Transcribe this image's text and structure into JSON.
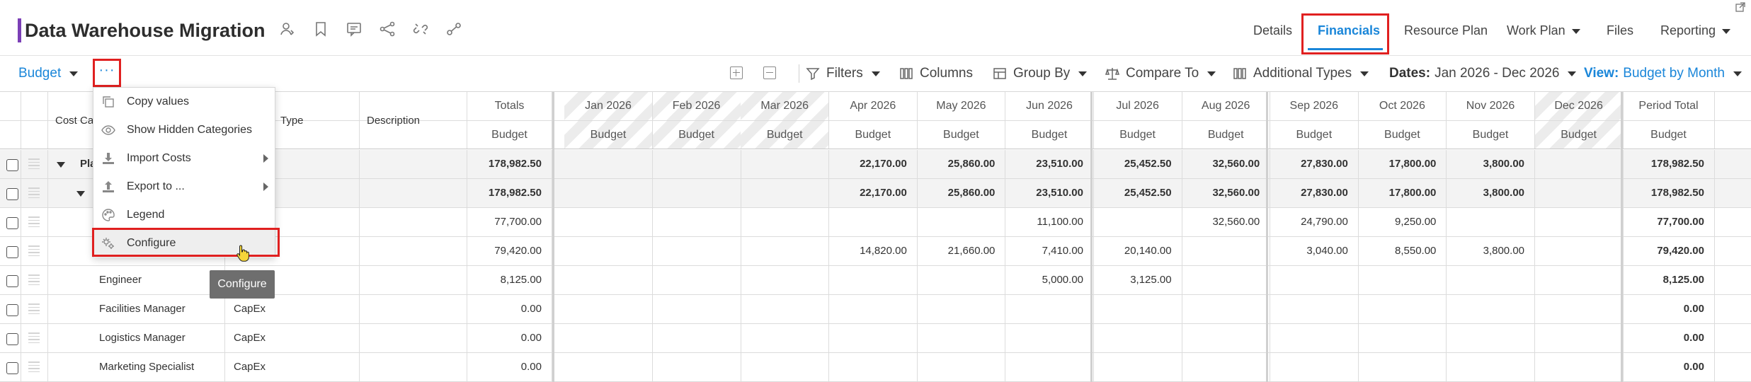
{
  "header": {
    "title": "Data Warehouse Migration",
    "icons": [
      "user-icon",
      "bookmark-icon",
      "comment-icon",
      "share-icon",
      "link-broken-icon",
      "link-icon"
    ],
    "tabs": [
      {
        "label": "Details",
        "active": false
      },
      {
        "label": "Financials",
        "active": true
      },
      {
        "label": "Resource Plan",
        "active": false
      },
      {
        "label": "Work Plan",
        "active": false,
        "dropdown": true
      },
      {
        "label": "Files",
        "active": false
      },
      {
        "label": "Reporting",
        "active": false,
        "dropdown": true
      }
    ],
    "accent_color": "#7b3fb6",
    "active_color": "#1a86d9",
    "highlight_color": "#e02020"
  },
  "toolbar": {
    "budget_label": "Budget",
    "more_label": "···",
    "filters_label": "Filters",
    "columns_label": "Columns",
    "group_by_label": "Group By",
    "compare_to_label": "Compare To",
    "additional_types_label": "Additional Types",
    "dates_prefix": "Dates:",
    "dates_value": "Jan 2026 - Dec 2026",
    "view_prefix": "View:",
    "view_value": "Budget by Month"
  },
  "menu": {
    "items": [
      {
        "label": "Copy values",
        "icon": "copy-icon"
      },
      {
        "label": "Show Hidden Categories",
        "icon": "eye-icon"
      },
      {
        "label": "Import Costs",
        "icon": "import-icon",
        "submenu": true
      },
      {
        "label": "Export to ...",
        "icon": "export-icon",
        "submenu": true
      },
      {
        "label": "Legend",
        "icon": "palette-icon"
      },
      {
        "label": "Configure",
        "icon": "gears-icon",
        "highlighted": true
      }
    ],
    "tooltip": "Configure"
  },
  "grid": {
    "headers": {
      "cost_category": "Cost Ca",
      "type": "Type",
      "description": "Description",
      "totals": "Totals",
      "months": [
        "Jan 2026",
        "Feb 2026",
        "Mar 2026",
        "Apr 2026",
        "May 2026",
        "Jun 2026",
        "Jul 2026",
        "Aug 2026",
        "Sep 2026",
        "Oct 2026",
        "Nov 2026",
        "Dec 2026"
      ],
      "period_total": "Period Total",
      "sub_label": "Budget"
    },
    "rows": [
      {
        "name": "Pla",
        "type": "",
        "total": "178,982.50",
        "months": [
          "",
          "",
          "",
          "22,170.00",
          "25,860.00",
          "23,510.00",
          "25,452.50",
          "32,560.00",
          "27,830.00",
          "17,800.00",
          "3,800.00",
          ""
        ],
        "period_total": "178,982.50",
        "bold": true,
        "shaded": true,
        "level": 0
      },
      {
        "name": "",
        "type": "",
        "total": "178,982.50",
        "months": [
          "",
          "",
          "",
          "22,170.00",
          "25,860.00",
          "23,510.00",
          "25,452.50",
          "32,560.00",
          "27,830.00",
          "17,800.00",
          "3,800.00",
          ""
        ],
        "period_total": "178,982.50",
        "bold": true,
        "shaded": true,
        "level": 1
      },
      {
        "name": "",
        "type": "",
        "total": "77,700.00",
        "months": [
          "",
          "",
          "",
          "",
          "",
          "11,100.00",
          "",
          "32,560.00",
          "24,790.00",
          "9,250.00",
          "",
          ""
        ],
        "period_total": "77,700.00",
        "bold": false,
        "shaded": false,
        "level": 2
      },
      {
        "name": "",
        "type": "",
        "total": "79,420.00",
        "months": [
          "",
          "",
          "",
          "14,820.00",
          "21,660.00",
          "7,410.00",
          "20,140.00",
          "",
          "3,040.00",
          "8,550.00",
          "3,800.00",
          ""
        ],
        "period_total": "79,420.00",
        "bold": false,
        "shaded": false,
        "level": 2
      },
      {
        "name": "Engineer",
        "type": "",
        "total": "8,125.00",
        "months": [
          "",
          "",
          "",
          "",
          "",
          "5,000.00",
          "3,125.00",
          "",
          "",
          "",
          "",
          ""
        ],
        "period_total": "8,125.00",
        "bold": false,
        "shaded": false,
        "level": 2
      },
      {
        "name": "Facilities Manager",
        "type": "CapEx",
        "total": "0.00",
        "months": [
          "",
          "",
          "",
          "",
          "",
          "",
          "",
          "",
          "",
          "",
          "",
          ""
        ],
        "period_total": "0.00",
        "bold": false,
        "shaded": false,
        "level": 2
      },
      {
        "name": "Logistics Manager",
        "type": "CapEx",
        "total": "0.00",
        "months": [
          "",
          "",
          "",
          "",
          "",
          "",
          "",
          "",
          "",
          "",
          "",
          ""
        ],
        "period_total": "0.00",
        "bold": false,
        "shaded": false,
        "level": 2
      },
      {
        "name": "Marketing Specialist",
        "type": "CapEx",
        "total": "0.00",
        "months": [
          "",
          "",
          "",
          "",
          "",
          "",
          "",
          "",
          "",
          "",
          "",
          ""
        ],
        "period_total": "0.00",
        "bold": false,
        "shaded": false,
        "level": 2
      }
    ]
  }
}
